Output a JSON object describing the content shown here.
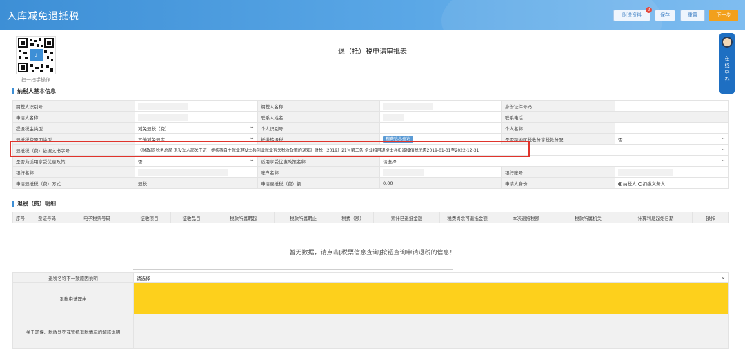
{
  "header": {
    "title": "入库减免退抵税",
    "buttons": {
      "attach": "附送资料",
      "attach_badge": "2",
      "save": "保存",
      "reset": "重置",
      "next": "下一步"
    }
  },
  "qr": {
    "caption": "扫一扫学操作"
  },
  "page_title": "退（抵）税申请审批表",
  "side_helper": {
    "label": "在线导办"
  },
  "basic_section": {
    "title": "纳税人基本信息"
  },
  "form": {
    "taxpayer_id_label": "纳税人识别号",
    "taxpayer_name_label": "纳税人名称",
    "id_number_label": "身份证件号码",
    "applicant_name_label": "申请人名称",
    "contact_name_label": "联系人姓名",
    "contact_phone_label": "联系电话",
    "refund_type_label": "提退税金类型",
    "refund_type_value": "减免退税（费）",
    "personal_id_label": "个人识别号",
    "personal_name_label": "个人名称",
    "reason_type_label": "退抵税费原因类型",
    "reason_type_value": "其他减免退库",
    "transfer_label": "抵缴转退税",
    "basis_query_btn": "税费信息查询",
    "region_share_label": "是否跨地区税收分享税款分配",
    "region_share_value": "否",
    "basis_doc_label": "退抵税（费）依据文书字号",
    "basis_doc_value": "《财政部 税务总局 退役军人部关于进一步扶持自主就业退役士兵创业就业有关税收政策的通知》财税〔2019〕21号第二条 企业招用退役士兵扣减增值税优惠2019-01-01至2022-12-31",
    "policy_label": "是否为适用享受优惠政策",
    "policy_value": "否",
    "policy_name_label": "适用享受优惠政策名称",
    "policy_name_value": "请选择",
    "bank_name_label": "银行名称",
    "account_name_label": "账户名称",
    "bank_account_label": "银行账号",
    "method_label": "申请退抵税（费）方式",
    "method_value": "退税",
    "amount_label": "申请退抵税（费）额",
    "amount_value": "0.00",
    "identity_label": "申请人身份",
    "identity_opt1": "纳税人",
    "identity_opt2": "扣缴义务人"
  },
  "detail_section": {
    "title": "退税（费）明细"
  },
  "detail_headers": [
    "序号",
    "票证号码",
    "电子税票号码",
    "征收项目",
    "征收品目",
    "税款所属期起",
    "税款所属期止",
    "税费（额）",
    "累计已退抵金额",
    "税费尚余可退抵金额",
    "本次退抵税额",
    "税款所属机关",
    "计算利息起始日期",
    "操作"
  ],
  "empty_message": "暂无数据，请点击[税票信息查询]按钮查询申请退税的信息！",
  "bottom": {
    "mismatch_label": "退税名称不一致原因说明",
    "mismatch_value": "请选择",
    "reason_label": "退税申请理由",
    "explain_label": "关于环保、税收处罚或管抵退税情况的解释说明"
  },
  "colors": {
    "header_blue": "#3d8fd6",
    "accent_orange": "#f2a01c",
    "highlight_red": "#e0342c",
    "reason_yellow": "#fdd01c"
  }
}
